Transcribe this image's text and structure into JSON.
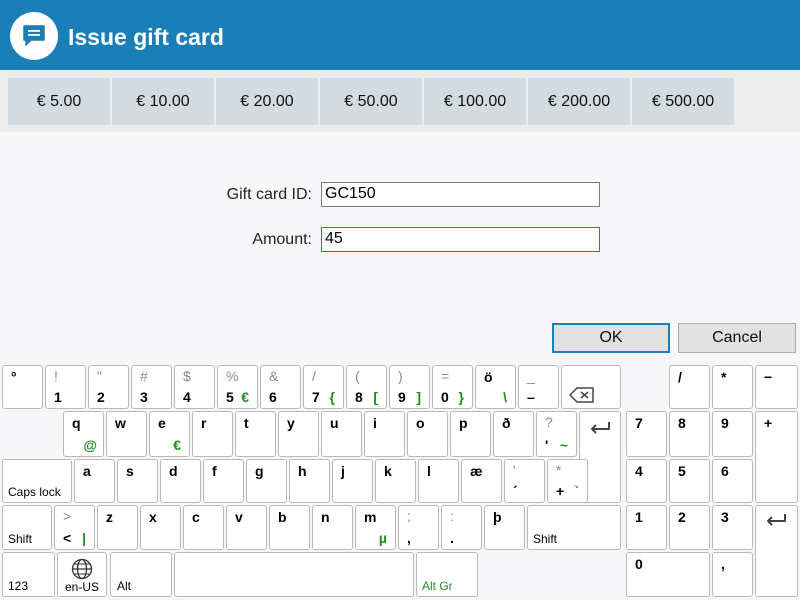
{
  "header": {
    "title": "Issue gift card",
    "icon": "chat-bubble-icon"
  },
  "amount_buttons": [
    "€ 5.00",
    "€ 10.00",
    "€ 20.00",
    "€ 50.00",
    "€ 100.00",
    "€ 200.00",
    "€ 500.00"
  ],
  "form": {
    "gift_card_id_label": "Gift card ID:",
    "gift_card_id_value": "GC150",
    "amount_label": "Amount:",
    "amount_value": "45"
  },
  "buttons": {
    "ok": "OK",
    "cancel": "Cancel"
  },
  "keyboard": {
    "row1": [
      {
        "main": "°",
        "shift": ""
      },
      {
        "main": "1",
        "shift": "!"
      },
      {
        "main": "2",
        "shift": "\""
      },
      {
        "main": "3",
        "shift": "#"
      },
      {
        "main": "4",
        "shift": "$"
      },
      {
        "main": "5",
        "shift": "%",
        "alt": "€"
      },
      {
        "main": "6",
        "shift": "&"
      },
      {
        "main": "7",
        "shift": "/",
        "alt": "{"
      },
      {
        "main": "8",
        "shift": "(",
        "alt": "["
      },
      {
        "main": "9",
        "shift": ")",
        "alt": "]"
      },
      {
        "main": "0",
        "shift": "=",
        "alt": "}"
      },
      {
        "main": "ö",
        "shift": "",
        "alt": "\\",
        "top": true
      },
      {
        "main": "–",
        "shift": "_"
      }
    ],
    "row2": [
      {
        "main": "q",
        "alt": "@"
      },
      {
        "main": "w"
      },
      {
        "main": "e",
        "alt": "€"
      },
      {
        "main": "r"
      },
      {
        "main": "t"
      },
      {
        "main": "y"
      },
      {
        "main": "u"
      },
      {
        "main": "i"
      },
      {
        "main": "o"
      },
      {
        "main": "p"
      },
      {
        "main": "ð"
      },
      {
        "main": "'",
        "shift": "?",
        "alt": "~"
      }
    ],
    "row3": [
      {
        "main": "a"
      },
      {
        "main": "s"
      },
      {
        "main": "d"
      },
      {
        "main": "f"
      },
      {
        "main": "g"
      },
      {
        "main": "h"
      },
      {
        "main": "j"
      },
      {
        "main": "k"
      },
      {
        "main": "l"
      },
      {
        "main": "æ"
      },
      {
        "main": "´",
        "shift": "'"
      },
      {
        "main": "+",
        "shift": "*",
        "alt": "`"
      }
    ],
    "row4": [
      {
        "main": "<",
        "shift": ">",
        "alt": "|"
      },
      {
        "main": "z"
      },
      {
        "main": "x"
      },
      {
        "main": "c"
      },
      {
        "main": "v"
      },
      {
        "main": "b"
      },
      {
        "main": "n"
      },
      {
        "main": "m",
        "alt": "µ"
      },
      {
        "main": ",",
        "shift": ";"
      },
      {
        "main": ".",
        "shift": ":"
      },
      {
        "main": "þ"
      }
    ],
    "labels": {
      "caps_lock": "Caps lock",
      "shift_left": "Shift",
      "shift_right": "Shift",
      "num_mode": "123",
      "language": "en-US",
      "alt": "Alt",
      "alt_gr": "Alt Gr"
    },
    "numpad": {
      "row1": [
        "/",
        "*",
        "−"
      ],
      "row2": [
        "7",
        "8",
        "9"
      ],
      "plus": "+",
      "row3": [
        "4",
        "5",
        "6"
      ],
      "row4": [
        "1",
        "2",
        "3"
      ],
      "zero": "0",
      "comma": ","
    }
  },
  "colors": {
    "header": "#1a7fb6",
    "amount_button": "#d4dbe0",
    "alt_char": "#218c21"
  }
}
